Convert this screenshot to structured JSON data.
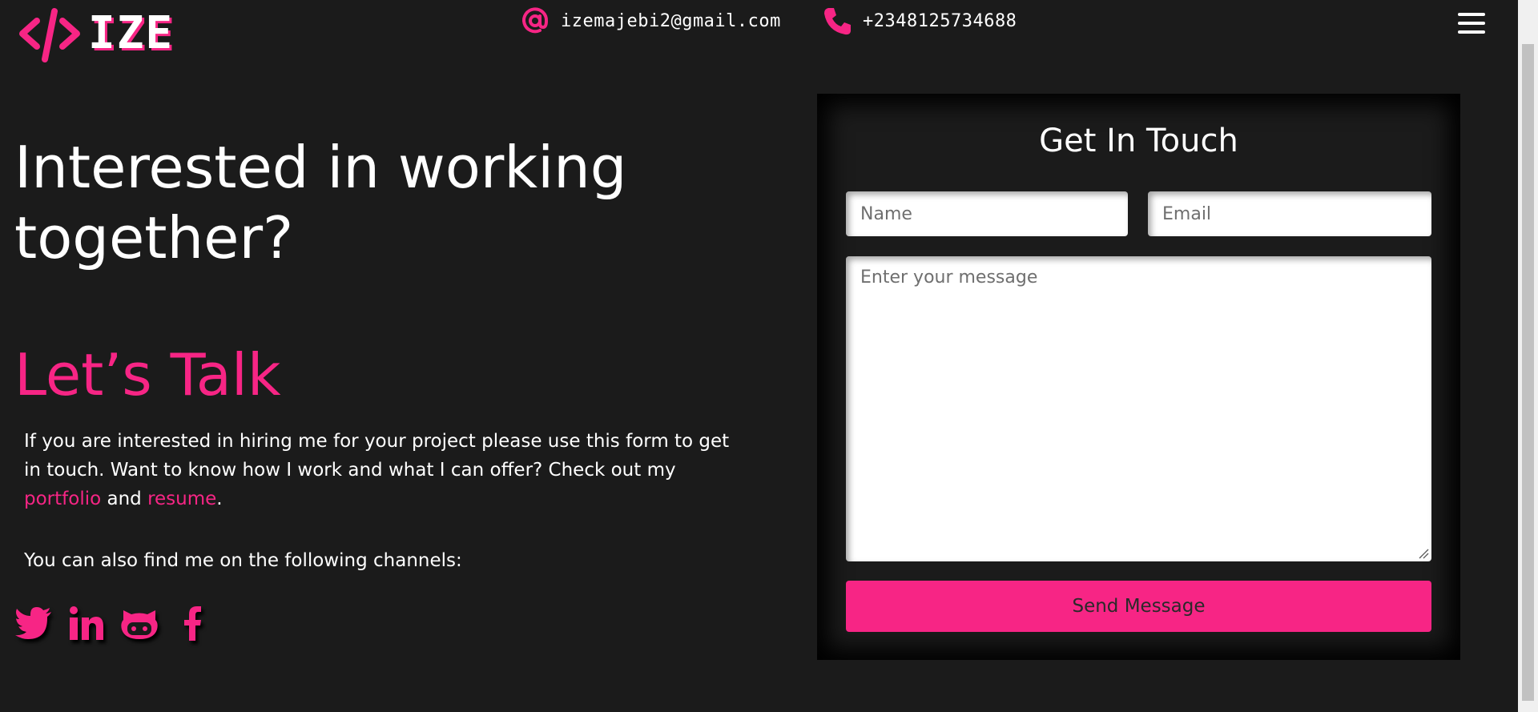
{
  "header": {
    "logo_text": "IZE",
    "email": "izemajebi2@gmail.com",
    "phone": "+2348125734688"
  },
  "hero": {
    "headline": "Interested in working together?",
    "subheadline": "Let’s Talk",
    "paragraph_start": "If you are interested in hiring me for your project please use this form to get in touch. Want to know how I work and what I can offer? Check out my ",
    "portfolio_link": "portfolio",
    "and_text": " and ",
    "resume_link": "resume",
    "period": ".",
    "channels_text": "You can also find me on the following channels:"
  },
  "social": [
    "twitter-icon",
    "linkedin-icon",
    "github-icon",
    "facebook-icon"
  ],
  "form": {
    "title": "Get In Touch",
    "name_placeholder": "Name",
    "email_placeholder": "Email",
    "message_placeholder": "Enter your message",
    "name_value": "",
    "email_value": "",
    "message_value": "",
    "submit_label": "Send Message"
  },
  "colors": {
    "background": "#1b1b1b",
    "accent": "#f72585",
    "text": "#ffffff"
  }
}
